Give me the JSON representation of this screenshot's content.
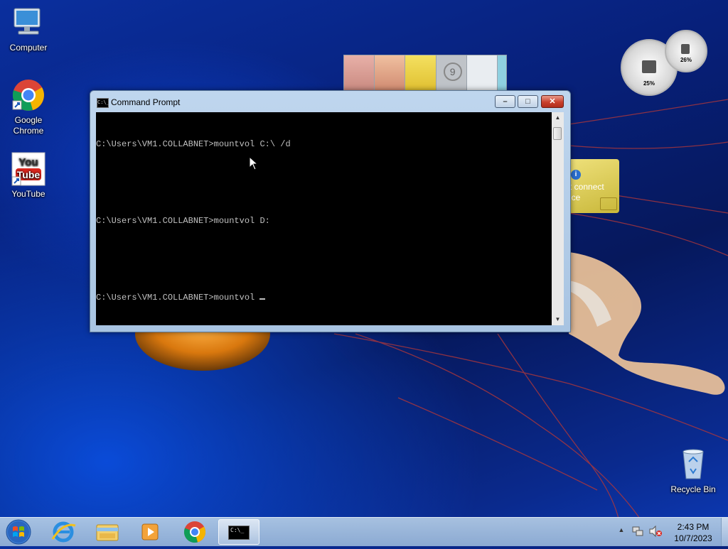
{
  "desktop": {
    "icons": [
      {
        "label": "Computer"
      },
      {
        "label": "Google Chrome"
      },
      {
        "label": "YouTube"
      },
      {
        "label": "Recycle Bin"
      }
    ],
    "youtube_logo": {
      "line1": "You",
      "line2": "Tube"
    }
  },
  "gadgets": {
    "cpu_meter": {
      "cpu_percent_label": "25%",
      "cpu_percent": 25,
      "memory_percent_label": "26%",
      "memory_percent": 26
    },
    "calendar_tile_number": "9",
    "notification_text_line1": "t connect",
    "notification_text_line2": "ice"
  },
  "cmd_window": {
    "title": "Command Prompt",
    "icon_text": "C:\\_",
    "lines": [
      "C:\\Users\\VM1.COLLABNET>mountvol C:\\ /d",
      "",
      "C:\\Users\\VM1.COLLABNET>mountvol D:",
      "",
      "C:\\Users\\VM1.COLLABNET>mountvol "
    ],
    "controls": {
      "minimize": "–",
      "maximize": "□",
      "close": "✕"
    }
  },
  "taskbar": {
    "pinned": [
      {
        "name": "internet-explorer-icon"
      },
      {
        "name": "file-explorer-icon"
      },
      {
        "name": "media-player-icon"
      },
      {
        "name": "chrome-icon"
      },
      {
        "name": "cmd-icon"
      }
    ],
    "cmd_icon_text": "C:\\_",
    "clock": {
      "time": "2:43 PM",
      "date": "10/7/2023"
    },
    "tray_icons": [
      "show-hidden-icons-arrow",
      "network-icon",
      "volume-muted-icon"
    ]
  },
  "colors": {
    "console_bg": "#000000",
    "console_fg": "#c0c0c0",
    "close_button": "#c9402d",
    "accent_blue": "#0a2f9e"
  }
}
